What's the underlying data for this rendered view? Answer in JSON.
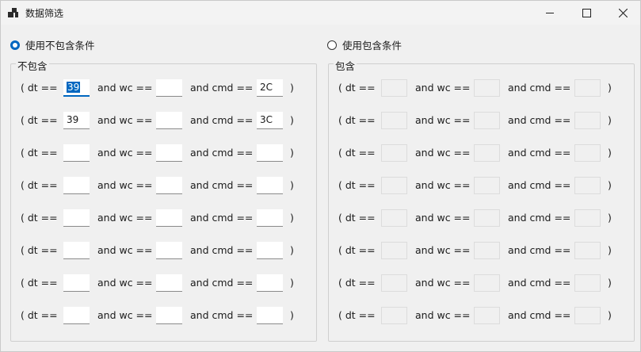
{
  "window": {
    "title": "数据筛选"
  },
  "radio_exclude": {
    "label": "使用不包含条件",
    "checked": true
  },
  "radio_include": {
    "label": "使用包含条件",
    "checked": false
  },
  "exclude_group": {
    "title": "不包含",
    "rows": [
      {
        "dt": "39",
        "wc": "",
        "cmd": "2C"
      },
      {
        "dt": "39",
        "wc": "",
        "cmd": "3C"
      },
      {
        "dt": "",
        "wc": "",
        "cmd": ""
      },
      {
        "dt": "",
        "wc": "",
        "cmd": ""
      },
      {
        "dt": "",
        "wc": "",
        "cmd": ""
      },
      {
        "dt": "",
        "wc": "",
        "cmd": ""
      },
      {
        "dt": "",
        "wc": "",
        "cmd": ""
      },
      {
        "dt": "",
        "wc": "",
        "cmd": ""
      }
    ]
  },
  "include_group": {
    "title": "包含",
    "rows": [
      {
        "dt": "",
        "wc": "",
        "cmd": ""
      },
      {
        "dt": "",
        "wc": "",
        "cmd": ""
      },
      {
        "dt": "",
        "wc": "",
        "cmd": ""
      },
      {
        "dt": "",
        "wc": "",
        "cmd": ""
      },
      {
        "dt": "",
        "wc": "",
        "cmd": ""
      },
      {
        "dt": "",
        "wc": "",
        "cmd": ""
      },
      {
        "dt": "",
        "wc": "",
        "cmd": ""
      },
      {
        "dt": "",
        "wc": "",
        "cmd": ""
      }
    ]
  },
  "labels": {
    "open": "( dt ==",
    "and_wc": "and wc ==",
    "and_cmd": "and cmd ==",
    "close": ")"
  },
  "icons": {
    "app": "app-icon",
    "minimize": "minimize-icon",
    "maximize": "maximize-icon",
    "close": "close-icon"
  }
}
